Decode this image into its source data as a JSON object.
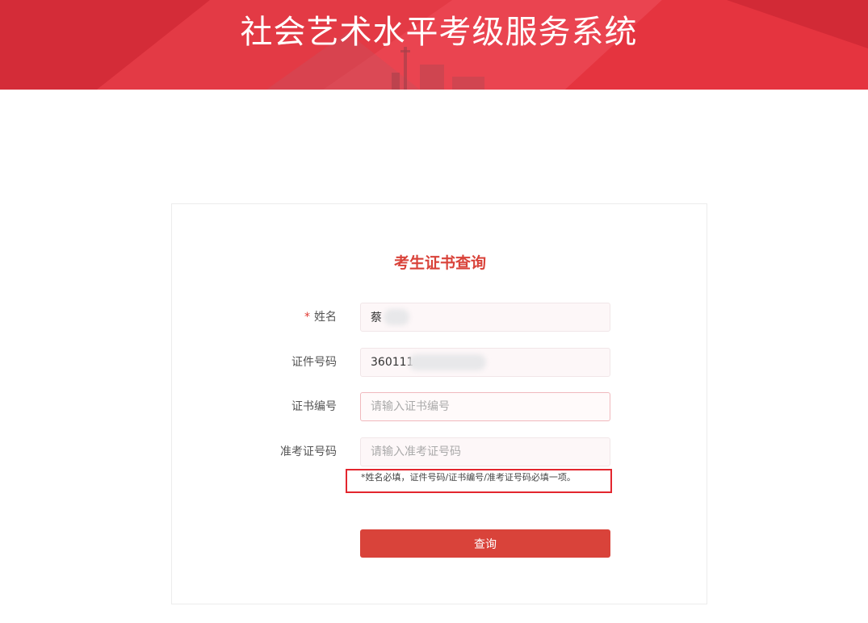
{
  "header": {
    "title": "社会艺术水平考级服务系统"
  },
  "form": {
    "title": "考生证书查询",
    "required_mark": "*",
    "fields": [
      {
        "label": "姓名",
        "value": "蔡",
        "placeholder": ""
      },
      {
        "label": "证件号码",
        "value": "360111",
        "placeholder": ""
      },
      {
        "label": "证书编号",
        "value": "",
        "placeholder": "请输入证书编号"
      },
      {
        "label": "准考证号码",
        "value": "",
        "placeholder": "请输入准考证号码"
      }
    ],
    "note": "*姓名必填，证件号码/证书编号/准考证号码必填一项。",
    "submit_label": "查询"
  },
  "colors": {
    "header_bg": "#e0313d",
    "accent": "#d9433a",
    "note_border": "#e3262e"
  }
}
